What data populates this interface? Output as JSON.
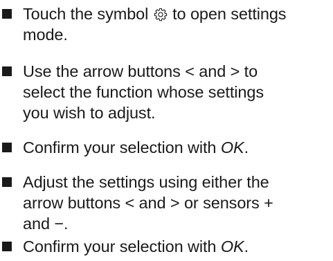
{
  "instructions": [
    {
      "lines": [
        {
          "before": "Touch the symbol ",
          "icon": "settings-gear-icon",
          "after": " to open settings"
        },
        {
          "text": "mode."
        }
      ]
    },
    {
      "lines": [
        {
          "text": "Use the arrow buttons < and > to"
        },
        {
          "text": "select the function whose settings"
        },
        {
          "text": "you wish to adjust."
        }
      ]
    },
    {
      "lines": [
        {
          "before": "Confirm your selection with ",
          "em": "OK",
          "after": "."
        }
      ]
    },
    {
      "lines": [
        {
          "text": "Adjust the settings using either the"
        },
        {
          "text": "arrow buttons < and > or sensors +"
        },
        {
          "text": "and −."
        }
      ]
    },
    {
      "lines": [
        {
          "before": "Confirm your selection with ",
          "em": "OK",
          "after": "."
        }
      ]
    }
  ]
}
